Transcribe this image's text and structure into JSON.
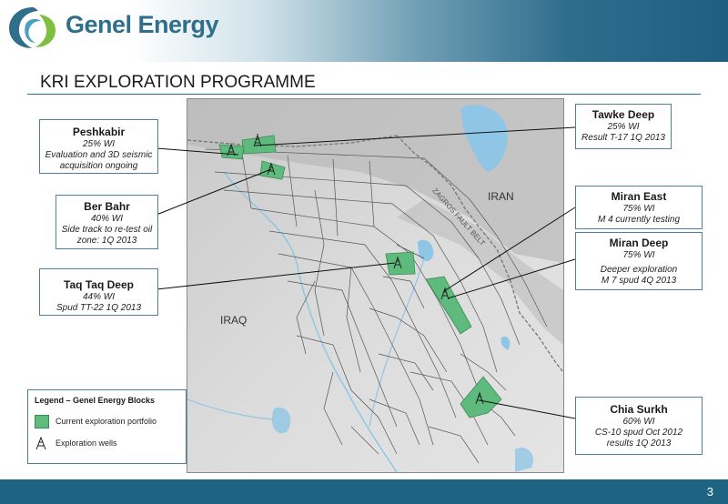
{
  "brand": {
    "name": "Genel Energy",
    "colors": {
      "primary": "#2f6f8b",
      "footer": "#1f6383",
      "block": "#5fba7d"
    }
  },
  "slide": {
    "title": "KRI EXPLORATION PROGRAMME",
    "page_number": "3"
  },
  "map": {
    "labels": {
      "iran": "IRAN",
      "iraq": "IRAQ",
      "fault": "ZAGROS FAULT BELT"
    }
  },
  "callouts": {
    "peshkabir": {
      "name": "Peshkabir",
      "lines": [
        "25% WI",
        "Evaluation and 3D seismic",
        "acquisition ongoing"
      ]
    },
    "ber_bahr": {
      "name": "Ber Bahr",
      "lines": [
        "40% WI",
        "Side track to re-test oil",
        "zone: 1Q 2013"
      ]
    },
    "taq_taq_deep": {
      "name": "Taq Taq Deep",
      "lines": [
        "44% WI",
        "Spud TT-22 1Q 2013"
      ]
    },
    "tawke_deep": {
      "name": "Tawke Deep",
      "lines": [
        "25% WI",
        "Result T-17 1Q 2013"
      ]
    },
    "miran_east": {
      "name": "Miran East",
      "lines": [
        "75% WI",
        "M 4 currently testing"
      ]
    },
    "miran_deep": {
      "name": "Miran Deep",
      "lines": [
        "75% WI",
        "Deeper exploration",
        "M 7 spud 4Q 2013"
      ]
    },
    "chia_surkh": {
      "name": "Chia Surkh",
      "lines": [
        "60% WI",
        "CS-10 spud Oct 2012",
        "results 1Q 2013"
      ]
    }
  },
  "legend": {
    "title": "Legend – Genel Energy Blocks",
    "items": [
      "Current exploration portfolio",
      "Exploration wells"
    ]
  },
  "icons": {
    "well": "oil-rig-icon",
    "logo": "genel-swirl-icon"
  }
}
